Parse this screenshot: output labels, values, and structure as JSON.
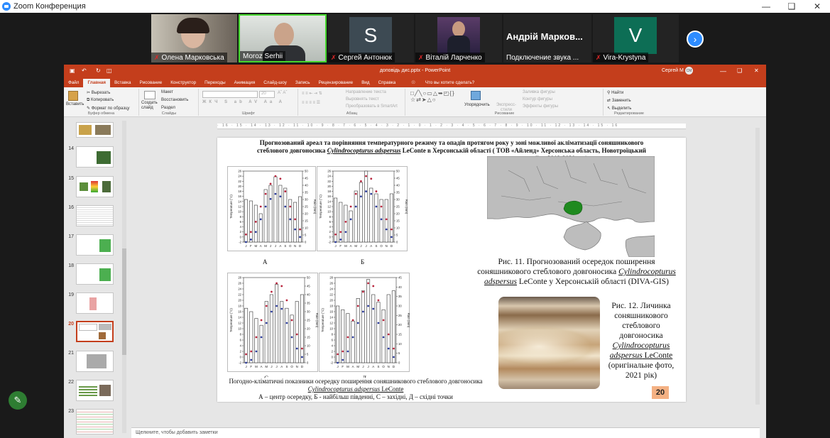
{
  "zoom": {
    "title": "Zoom Конференция",
    "participants": [
      {
        "name": "Олена Марковська",
        "muted": true,
        "kind": "video"
      },
      {
        "name": "Moroz Serhii",
        "muted": false,
        "kind": "video"
      },
      {
        "name": "Сергей Антонюк",
        "muted": true,
        "kind": "avatar",
        "initial": "S",
        "color": "#3d4a53"
      },
      {
        "name": "Віталій Ларченко",
        "muted": true,
        "kind": "video"
      },
      {
        "name": "Подключение звука ...",
        "muted": false,
        "kind": "text",
        "display": "Андрій Марков..."
      },
      {
        "name": "Vira-Krystyna",
        "muted": true,
        "kind": "avatar",
        "initial": "V",
        "color": "#0d6e55"
      }
    ]
  },
  "ppt": {
    "title": "доповідь дис.pptx  -  PowerPoint",
    "user": "Сергей М",
    "user_initials": "СМ",
    "tabs": [
      "Файл",
      "Главная",
      "Вставка",
      "Рисование",
      "Конструктор",
      "Переходы",
      "Анимация",
      "Слайд-шоу",
      "Запись",
      "Рецензирование",
      "Вид",
      "Справка"
    ],
    "active_tab": "Главная",
    "tell_me": "Что вы хотите сделать?",
    "ribbon": {
      "paste": "Вставить",
      "cut": "Вырезать",
      "copy": "Копировать",
      "format_painter": "Формат по образцу",
      "clipboard": "Буфер обмена",
      "new_slide": "Создать слайд",
      "layout": "Макет",
      "reset": "Восстановить",
      "section": "Раздел",
      "slides": "Слайды",
      "font_size": "20",
      "font": "Шрифт",
      "text_direction": "Направление текста",
      "align_text": "Выровнять текст",
      "smartart": "Преобразовать в SmartArt",
      "paragraph": "Абзац",
      "arrange": "Упорядочить",
      "quick_styles": "Экспресс-стили",
      "shape_fill": "Заливка фигуры",
      "shape_outline": "Контур фигуры",
      "shape_effects": "Эффекты фигуры",
      "drawing": "Рисование",
      "find": "Найти",
      "replace": "Заменить",
      "select": "Выделить",
      "editing": "Редактирование"
    },
    "thumbnails": [
      "14",
      "15",
      "16",
      "17",
      "18",
      "19",
      "20",
      "21",
      "22",
      "23"
    ],
    "selected_thumb": "20",
    "notes": "Щелкните, чтобы добавить заметки"
  },
  "slide": {
    "title_line1": "Прогнозований ареал та порівняння температурного режиму та опадів протягом року у зоні можливої акліматизації соняшникового",
    "title_line2a": "стеблового довгоносика ",
    "title_species": "Cylindrocopturus adspersus",
    "title_line2b": " LeConte в Херсонській області ( ТОВ «Айленд» Херсонська область, Новотроїцький",
    "title_line3": "район 2019-2020 рр.)",
    "fig11_line1": "Рис. 11. Прогнозований осередок поширення",
    "fig11_line2a": "соняшникового стеблового довгоносика ",
    "fig11_species1": "Cylindrocopturus",
    "fig11_species2": "adspersus",
    "fig11_line3b": " LeConte у Херсонській області (DIVA-GIS)",
    "fig12_line1": "Рис. 12. Личинка",
    "fig12_line2": "соняшникового",
    "fig12_line3": "стеблового",
    "fig12_line4": "довгоносика",
    "fig12_species1": "Cylindrocopturus",
    "fig12_species2": "adspersus",
    "fig12_line6b": " LeConte",
    "fig12_line7": "(оригінальне фото,",
    "fig12_line8": "2021 рік)",
    "charts_caption1": "Погодно-кліматичні показники осередку поширення соняшникового стеблового довгоносика",
    "charts_caption_species": "Cylindrocopturus adspersus",
    "charts_caption_author": " LeConte",
    "charts_caption2": "А – центр осередку, Б - найбільш південні, С – західні, Д – східні точки",
    "page_number": "20",
    "chart_labels": [
      "А",
      "Б",
      "С",
      "Д"
    ]
  },
  "chart_data": [
    {
      "type": "bar",
      "title": "А",
      "categories": [
        "J",
        "F",
        "M",
        "A",
        "M",
        "J",
        "J",
        "A",
        "S",
        "O",
        "N",
        "D"
      ],
      "ylabel": "Temperature (°C)",
      "y2label": "Rain (mm)",
      "ylim": [
        -2,
        26
      ],
      "y2lim": [
        0,
        50
      ],
      "series": [
        {
          "kind": "bar",
          "axis": "right",
          "values": [
            30,
            29,
            26,
            20,
            37,
            40,
            46,
            40,
            38,
            30,
            28,
            32
          ]
        },
        {
          "kind": "point",
          "color": "#b8243c",
          "axis": "left",
          "values": [
            1,
            2,
            6,
            12,
            17,
            21,
            24,
            23,
            18,
            12,
            7,
            3
          ]
        },
        {
          "kind": "point",
          "color": "#2a3a9a",
          "axis": "left",
          "values": [
            -2,
            -1,
            2,
            7,
            12,
            15,
            17,
            16,
            12,
            7,
            3,
            0
          ]
        }
      ]
    },
    {
      "type": "bar",
      "title": "Б",
      "categories": [
        "J",
        "F",
        "M",
        "A",
        "M",
        "J",
        "J",
        "A",
        "S",
        "O",
        "N",
        "D"
      ],
      "ylabel": "Temperature (°C)",
      "y2label": "Rain (mm)",
      "ylim": [
        -2,
        26
      ],
      "y2lim": [
        0,
        50
      ],
      "series": [
        {
          "kind": "bar",
          "axis": "right",
          "values": [
            31,
            28,
            26,
            22,
            36,
            42,
            50,
            38,
            34,
            30,
            30,
            34
          ]
        },
        {
          "kind": "point",
          "color": "#b8243c",
          "axis": "left",
          "values": [
            1,
            2,
            6,
            12,
            17,
            22,
            24,
            23,
            18,
            12,
            7,
            3
          ]
        },
        {
          "kind": "point",
          "color": "#2a3a9a",
          "axis": "left",
          "values": [
            -2,
            -1,
            2,
            7,
            12,
            16,
            18,
            17,
            12,
            7,
            3,
            0
          ]
        }
      ]
    },
    {
      "type": "bar",
      "title": "С",
      "categories": [
        "J",
        "F",
        "M",
        "A",
        "M",
        "J",
        "J",
        "A",
        "S",
        "O",
        "N",
        "D"
      ],
      "ylabel": "Temperature (°C)",
      "y2label": "Rain (mm)",
      "ylim": [
        -2,
        28
      ],
      "y2lim": [
        0,
        50
      ],
      "series": [
        {
          "kind": "bar",
          "axis": "right",
          "values": [
            32,
            30,
            26,
            22,
            36,
            40,
            46,
            36,
            32,
            28,
            36,
            40
          ]
        },
        {
          "kind": "point",
          "color": "#b8243c",
          "axis": "left",
          "values": [
            1,
            2,
            7,
            13,
            18,
            23,
            26,
            25,
            20,
            13,
            8,
            3
          ]
        },
        {
          "kind": "point",
          "color": "#2a3a9a",
          "axis": "left",
          "values": [
            -2,
            -1,
            2,
            7,
            12,
            16,
            18,
            17,
            12,
            7,
            3,
            0
          ]
        }
      ]
    },
    {
      "type": "bar",
      "title": "Д",
      "categories": [
        "J",
        "F",
        "M",
        "A",
        "M",
        "J",
        "J",
        "A",
        "S",
        "O",
        "N",
        "D"
      ],
      "ylabel": "Temperature (°C)",
      "y2label": "Rain (mm)",
      "ylim": [
        -2,
        28
      ],
      "y2lim": [
        0,
        45
      ],
      "series": [
        {
          "kind": "bar",
          "axis": "right",
          "values": [
            30,
            28,
            26,
            22,
            34,
            38,
            44,
            36,
            32,
            28,
            36,
            38
          ]
        },
        {
          "kind": "point",
          "color": "#b8243c",
          "axis": "left",
          "values": [
            1,
            2,
            7,
            13,
            18,
            23,
            26,
            25,
            20,
            13,
            8,
            3
          ]
        },
        {
          "kind": "point",
          "color": "#2a3a9a",
          "axis": "left",
          "values": [
            -2,
            -1,
            2,
            7,
            12,
            16,
            18,
            17,
            12,
            7,
            3,
            0
          ]
        }
      ]
    }
  ]
}
